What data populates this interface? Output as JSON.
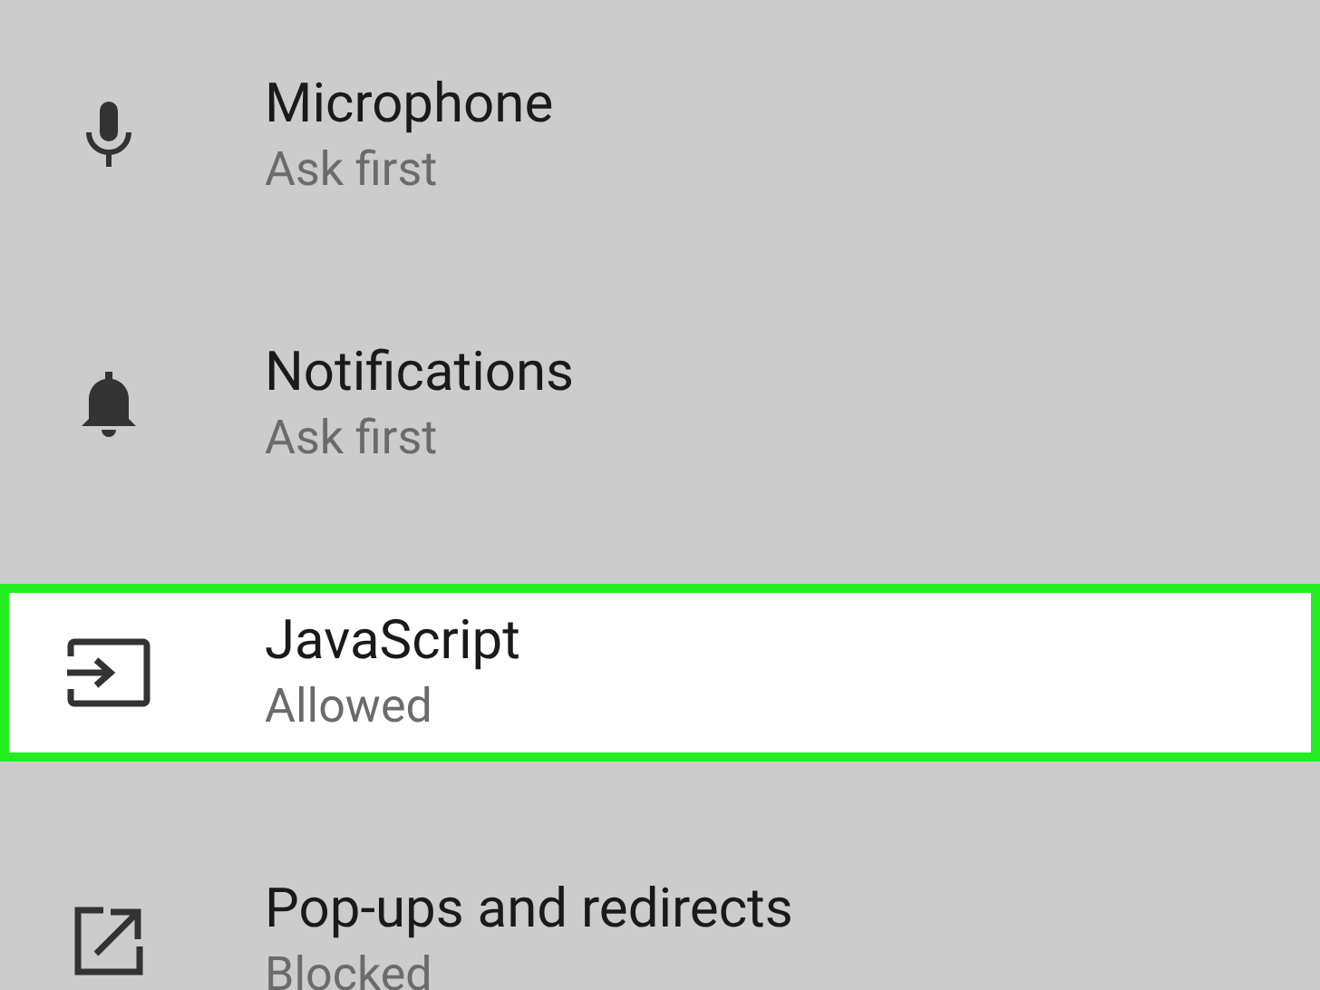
{
  "settings": [
    {
      "kind": "microphone",
      "title": "Microphone",
      "status": "Ask first",
      "highlighted": false
    },
    {
      "kind": "bell",
      "title": "Notifications",
      "status": "Ask first",
      "highlighted": false
    },
    {
      "kind": "input",
      "title": "JavaScript",
      "status": "Allowed",
      "highlighted": true
    },
    {
      "kind": "external",
      "title": "Pop-ups and redirects",
      "status": "Blocked",
      "highlighted": false
    }
  ]
}
